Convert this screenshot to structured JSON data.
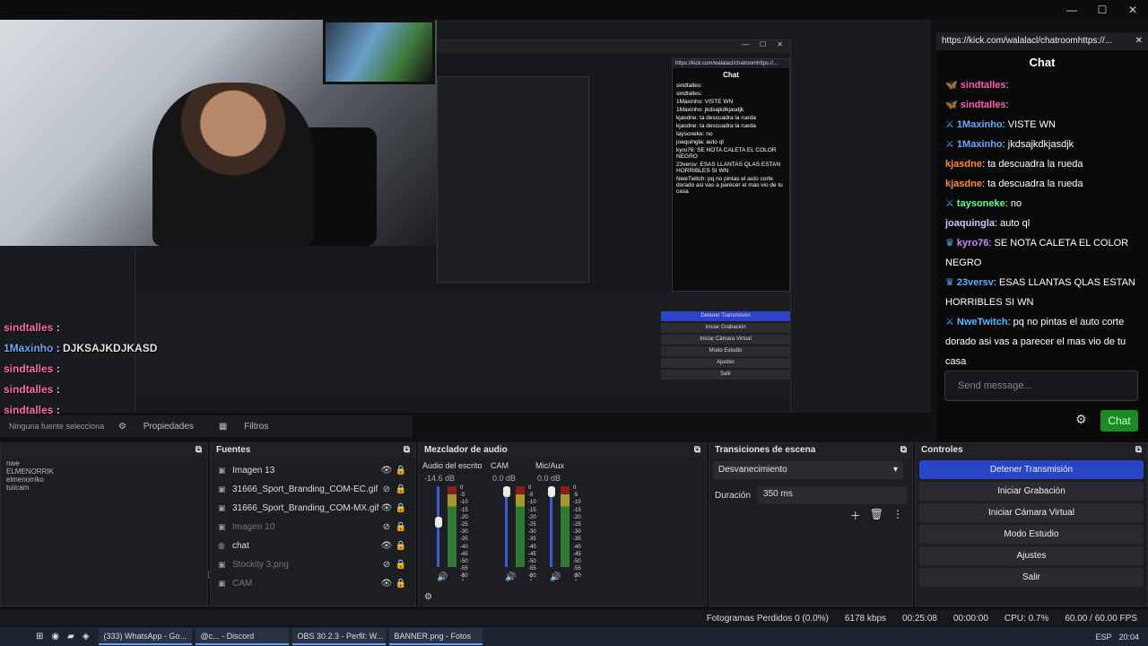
{
  "window": {
    "minimize": "—",
    "maximize": "☐",
    "close": "✕"
  },
  "kick": {
    "url": "https://kick.com/walalacl/chatroomhttps://...",
    "close": "✕",
    "title": "Chat",
    "messages": [
      {
        "user": "sindtalles",
        "sep": ":",
        "text": "",
        "color": "#ff5fa8",
        "badge": "🦋"
      },
      {
        "user": "sindtalles",
        "sep": ":",
        "text": "",
        "color": "#ff5fa8",
        "badge": "🦋"
      },
      {
        "user": "1Maxinho",
        "sep": ":",
        "text": " VISTE WN",
        "color": "#6aa7ff",
        "badge": "⚔"
      },
      {
        "user": "1Maxinho",
        "sep": ":",
        "text": " jkdsajkdkjasdjk",
        "color": "#6aa7ff",
        "badge": "⚔"
      },
      {
        "user": "kjasdne",
        "sep": ":",
        "text": " ta descuadra la rueda",
        "color": "#ff8a3c",
        "badge": ""
      },
      {
        "user": "kjasdne",
        "sep": ":",
        "text": " ta descuadra la rueda",
        "color": "#ff8a3c",
        "badge": ""
      },
      {
        "user": "taysoneke",
        "sep": ":",
        "text": " no",
        "color": "#5dff8f",
        "badge": "⚔"
      },
      {
        "user": "joaquingla",
        "sep": ":",
        "text": " auto ql",
        "color": "#c9c9ff",
        "badge": ""
      },
      {
        "user": "kyro76",
        "sep": ":",
        "text": " SE NOTA CALETA EL COLOR NEGRO",
        "color": "#c58bff",
        "badge": "♛"
      },
      {
        "user": "23versv",
        "sep": ":",
        "text": " ESAS LLANTAS QLAS ESTAN HORRIBLES SI WN",
        "color": "#6aa7ff",
        "badge": "♛"
      },
      {
        "user": "NweTwitch",
        "sep": ":",
        "text": " pq no pintas el auto corte dorado asi vas a parecer el mas vio de tu casa",
        "color": "#5ab8ff",
        "badge": "⚔"
      }
    ],
    "send_placeholder": "Send message...",
    "chat_button": "Chat"
  },
  "overlay": [
    {
      "user": "sindtalles",
      "text": " : ",
      "color": "#ff6fb0"
    },
    {
      "user": "1Maxinho",
      "text": " : DJKSAJKDJKASD",
      "color": "#6fa9ff"
    },
    {
      "user": "sindtalles",
      "text": " : ",
      "color": "#ff6fb0"
    },
    {
      "user": "sindtalles",
      "text": " : ",
      "color": "#ff6fb0"
    },
    {
      "user": "sindtalles",
      "text": " : ",
      "color": "#ff6fb0"
    },
    {
      "user": "sindtalles",
      "text": " : ",
      "color": "#ff6fb0"
    },
    {
      "user": "1Maxinho",
      "text": " : VISTE WN",
      "color": "#6fa9ff"
    },
    {
      "user": "1Maxinho",
      "text": " : jkdsajkdkjasdjk",
      "color": "#6fa9ff"
    },
    {
      "user": "kjasdne",
      "text": " : ta descuadra la rueda",
      "color": "#ff8c3c"
    },
    {
      "user": "kjasdne",
      "text": " : ta descuadra la rueda",
      "color": "#ff8c3c"
    },
    {
      "user": "taysoneke",
      "text": " : no",
      "color": "#5dff8f"
    },
    {
      "user": "joaquingla",
      "text": " : auto ql",
      "color": "#d0d0ff"
    },
    {
      "user": "kyro76",
      "text": " : SE NOTA CALETA EL COLOR NEGRO",
      "color": "#c58bff"
    },
    {
      "user": "23versv",
      "text": " : ESAS LLANTAS QLAS ESTAN HORRIBLES SI WN",
      "color": "#6fa9ff"
    },
    {
      "user": "NweTwitch",
      "text": " : pq no pintas el auto corte dorado asi vas a parecer el mas vio de",
      "color": "#ffb02e"
    }
  ],
  "overlay_tail": "tu casa",
  "nested": {
    "chat_url": "https://kick.com/walalacl/chatroomhttps://...",
    "chat_title": "Chat",
    "chat_lines": [
      "sindtalles: ",
      "sindtalles: ",
      "1Maxinho: VISTE WN",
      "1Maxinho: jkdsajkdkjasdjk",
      "kjasdne: ta descuadra la rueda",
      "kjasdne: ta descuadra la rueda",
      "taysoneke: no",
      "joaquingla: auto ql",
      "kyro76: SE NOTA CALETA EL COLOR NEGRO",
      "23versv: ESAS LLANTAS QLAS ESTAN HORRIBLES SI WN",
      "NweTwitch: pq no pintas el auto corte dorado asi vas a parecer el mas vio de tu casa"
    ],
    "send": "Send message...",
    "chat_btn": "Chat",
    "controls": [
      "Detener Transmisión",
      "Iniciar Grabación",
      "Iniciar Cámara Virtual",
      "Modo Estudio",
      "Ajustes",
      "Salir"
    ]
  },
  "props": {
    "no_source": "Ninguna fuente seleccionada",
    "properties": "Propiedades",
    "filters": "Filtros"
  },
  "docks": {
    "sources_title": "Fuentes",
    "mixer_title": "Mezclador de audio",
    "transitions_title": "Transiciones de escena",
    "controls_title": "Controles"
  },
  "scenes": [
    "nwe",
    "ELMENORRIK",
    "elmenorriko",
    "tuiicam"
  ],
  "sources": [
    {
      "name": "Imagen 13",
      "dim": false,
      "icon": "▣",
      "eye": "👁"
    },
    {
      "name": "31666_Sport_Branding_COM-EC.gif",
      "dim": false,
      "icon": "▣",
      "eye": "⊘"
    },
    {
      "name": "31666_Sport_Branding_COM-MX.gif",
      "dim": false,
      "icon": "▣",
      "eye": "👁"
    },
    {
      "name": "Imagen 10",
      "dim": true,
      "icon": "▣",
      "eye": "⊘"
    },
    {
      "name": "chat",
      "dim": false,
      "icon": "◍",
      "eye": "👁"
    },
    {
      "name": "Stockity 3.png",
      "dim": true,
      "icon": "▣",
      "eye": "⊘"
    },
    {
      "name": "CAM",
      "dim": true,
      "icon": "▣",
      "eye": "👁"
    }
  ],
  "mixer": {
    "channels": [
      {
        "name": "Audio del escrito",
        "db": "-14.6 dB"
      },
      {
        "name": "CAM",
        "db": "0.0 dB"
      },
      {
        "name": "Mic/Aux",
        "db": "0.0 dB"
      }
    ],
    "scale": [
      "0",
      "-5",
      "-10",
      "-15",
      "-20",
      "-25",
      "-30",
      "-35",
      "-40",
      "-45",
      "-50",
      "-55",
      "-60"
    ]
  },
  "transitions": {
    "selected": "Desvanecimiento",
    "duration_label": "Duración",
    "duration": "350 ms"
  },
  "controls": [
    "Detener Transmisión",
    "Iniciar Grabación",
    "Iniciar Cámara Virtual",
    "Modo Estudio",
    "Ajustes",
    "Salir"
  ],
  "status": {
    "dropped": "Fotogramas Perdidos 0 (0.0%)",
    "bitrate": "6178 kbps",
    "stream_time": "00:25:08",
    "rec_time": "00:00:00",
    "cpu": "CPU: 0.7%",
    "fps": "60.00 / 60.00 FPS"
  },
  "taskbar": {
    "items": [
      "(333) WhatsApp - Go...",
      "@c... - Discord",
      "OBS 30.2.3 - Perfil: W...",
      "BANNER.png - Fotos"
    ],
    "lang": "ESP",
    "time": "20:04"
  }
}
